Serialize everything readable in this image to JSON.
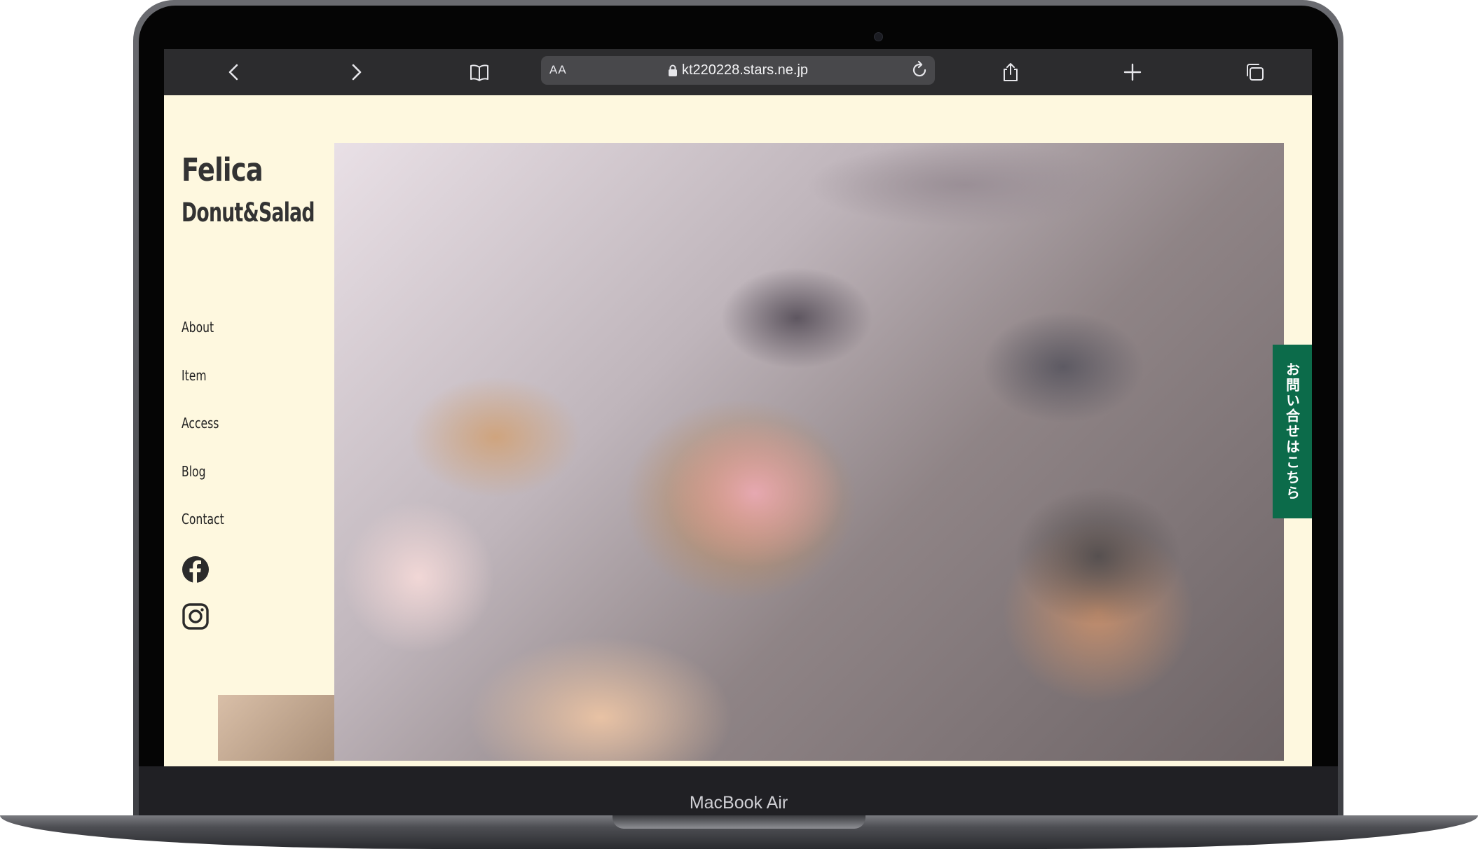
{
  "device": {
    "model_label": "MacBook Air"
  },
  "browser": {
    "text_size_label": "AA",
    "url": "kt220228.stars.ne.jp",
    "icons": [
      "back-icon",
      "forward-icon",
      "bookmarks-icon",
      "lock-icon",
      "reload-icon",
      "share-icon",
      "new-tab-icon",
      "tabs-icon"
    ]
  },
  "site": {
    "logo_line1": "Felica",
    "logo_line2": "Donut&Salad",
    "nav": [
      {
        "label": "About"
      },
      {
        "label": "Item"
      },
      {
        "label": "Access"
      },
      {
        "label": "Blog"
      },
      {
        "label": "Contact"
      }
    ],
    "social": [
      "facebook-icon",
      "instagram-icon"
    ],
    "contact_tab": "お問い合せはこちら",
    "colors": {
      "background": "#fef8df",
      "contact_tab": "#0c6b4a",
      "text": "#333333"
    }
  }
}
